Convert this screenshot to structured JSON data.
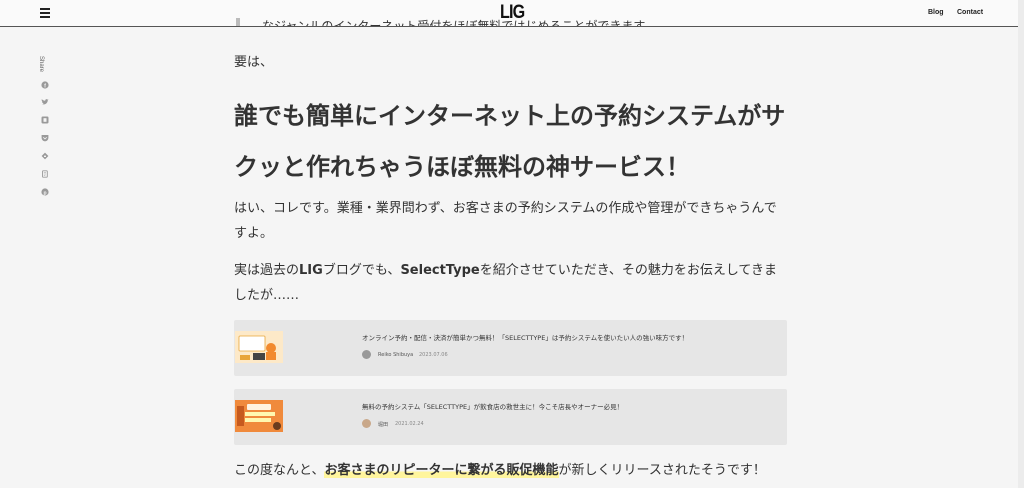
{
  "header": {
    "logo": "LIG",
    "nav": {
      "blog": "Blog",
      "contact": "Contact"
    }
  },
  "share": {
    "label": "Share",
    "icons": [
      "facebook-icon",
      "twitter-icon",
      "hatena-icon",
      "pocket-icon",
      "feedly-icon",
      "copy-icon",
      "pinterest-icon"
    ]
  },
  "article": {
    "top_line": "なジャンルのインターネット受付をほぼ無料ではじめることができます。",
    "p_summary": "要は、",
    "heading": "誰でも簡単にインターネット上の予約システムがサクッと作れちゃうほぼ無料の神サービス！",
    "p_intro": "はい、コレです。業種・業界問わず、お客さまの予約システムの作成や管理ができちゃうんですよ。",
    "p_past_1": "実は過去の",
    "p_past_bold1": "LIG",
    "p_past_2": "ブログでも、",
    "p_past_bold2": "SelectType",
    "p_past_3": "を紹介させていただき、その魅力をお伝えしてきましたが……",
    "p_new_1": "この度なんと、",
    "p_new_highlight": "お客さまのリピーターに繋がる販促機能",
    "p_new_2": "が新しくリリースされたそうです！"
  },
  "cards": [
    {
      "title": "オンライン予約・配信・決済が簡単かつ無料！「SELECTTYPE」は予約システムを使いたい人の強い味方です！",
      "author": "Reiko Shibuya",
      "date": "2023.07.06"
    },
    {
      "title": "無料の予約システム「SELECTTYPE」が飲食店の救世主に！今こそ店長やオーナー必見！",
      "author": "堀田",
      "date": "2021.02.24"
    }
  ]
}
